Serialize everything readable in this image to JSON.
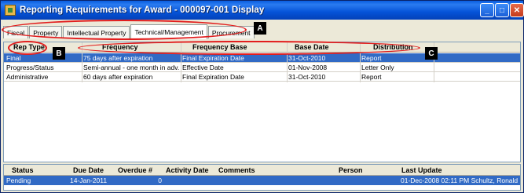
{
  "window": {
    "title": "Reporting Requirements for Award - 000097-001 Display",
    "minimize": "_",
    "maximize": "□",
    "close": "✕"
  },
  "tabs": [
    {
      "label": "Fiscal"
    },
    {
      "label": "Property"
    },
    {
      "label": "Intellectual Property"
    },
    {
      "label": "Technical/Management"
    },
    {
      "label": "Procurement"
    }
  ],
  "callouts": {
    "a": "A",
    "b": "B",
    "c": "C"
  },
  "requirements_table": {
    "headers": {
      "report_type": "Rep Type",
      "frequency": "Frequency",
      "frequency_base": "Frequency Base",
      "base_date": "Base Date",
      "distribution": "Distribution"
    },
    "rows": [
      {
        "report_type": "Final",
        "frequency": "75 days after expiration",
        "frequency_base": "Final Expiration Date",
        "base_date": "31-Oct-2010",
        "distribution": "Report"
      },
      {
        "report_type": "Progress/Status",
        "frequency": "Semi-annual - one month in adv...",
        "frequency_base": "Effective Date",
        "base_date": "01-Nov-2008",
        "distribution": "Letter Only"
      },
      {
        "report_type": "Administrative",
        "frequency": "60 days after expiration",
        "frequency_base": "Final Expiration Date",
        "base_date": "31-Oct-2010",
        "distribution": "Report"
      }
    ]
  },
  "tracking_table": {
    "headers": {
      "status": "Status",
      "due_date": "Due Date",
      "overdue": "Overdue #",
      "activity_date": "Activity Date",
      "comments": "Comments",
      "person": "Person",
      "last_update": "Last Update"
    },
    "rows": [
      {
        "status": "Pending",
        "due_date": "14-Jan-2011",
        "overdue": "0",
        "activity_date": "",
        "comments": "",
        "person": "",
        "last_update": "01-Dec-2008 02:11 PM Schultz, Ronald"
      }
    ]
  },
  "colors": {
    "selection": "#316ac5",
    "annotation": "#e21d1d",
    "titlebar": "#0553d8"
  }
}
